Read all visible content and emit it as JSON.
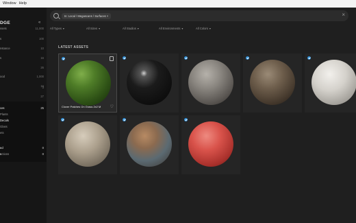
{
  "menubar": {
    "items": [
      "Window",
      "Help"
    ]
  },
  "sidebar": {
    "logo": "DGE",
    "collapse_glyph": "«",
    "top_rows": [
      {
        "label": "ssets",
        "count": "11,000"
      },
      {
        "label": "s",
        "count": "100"
      },
      {
        "label": "nstance",
        "count": "10"
      },
      {
        "label": "s",
        "count": "16"
      },
      {
        "label": "",
        "count": "26"
      },
      {
        "label": "ood",
        "count": "1,000"
      },
      {
        "label": "",
        "count": "16"
      },
      {
        "label": "",
        "count": "3"
      },
      {
        "label": "",
        "count": "27"
      }
    ],
    "section_rows": [
      {
        "label": "ces",
        "count": "25"
      },
      {
        "label": "Plants",
        "count": ""
      },
      {
        "label": "Decals",
        "count": ""
      },
      {
        "label": "Glass",
        "count": ""
      },
      {
        "label": "ets",
        "count": ""
      },
      {
        "label": "",
        "count": ""
      },
      {
        "label": "ed",
        "count": "0"
      },
      {
        "label": "s",
        "count": "0"
      },
      {
        "label": "ections",
        "count": "3"
      }
    ]
  },
  "search": {
    "chip_label": "In: Local / Megascans / Surfaces",
    "chip_close": "×",
    "close_glyph": "×"
  },
  "filters": [
    "All Types",
    "All Sizes",
    "All Studios",
    "All Environments",
    "All Colors"
  ],
  "section_title": "LATEST ASSETS",
  "assets": [
    {
      "title": "Clover Patches On Grass 2x2 M",
      "selected": true,
      "bookmark": true,
      "material": "clover-grass"
    },
    {
      "title": "",
      "selected": false,
      "material": "black-tiles"
    },
    {
      "title": "",
      "selected": false,
      "material": "gravel-concrete"
    },
    {
      "title": "",
      "selected": false,
      "material": "rocky-dirt"
    },
    {
      "title": "",
      "selected": false,
      "material": "white-panels"
    },
    {
      "title": "",
      "selected": false,
      "material": "layered-stone"
    },
    {
      "title": "",
      "selected": false,
      "material": "rusty-metal"
    },
    {
      "title": "",
      "selected": false,
      "material": "red-painted-metal"
    }
  ],
  "colors": {
    "accent_badge": "#2f8fd8",
    "background": "#1f1f1f",
    "sidebar": "#161616"
  }
}
